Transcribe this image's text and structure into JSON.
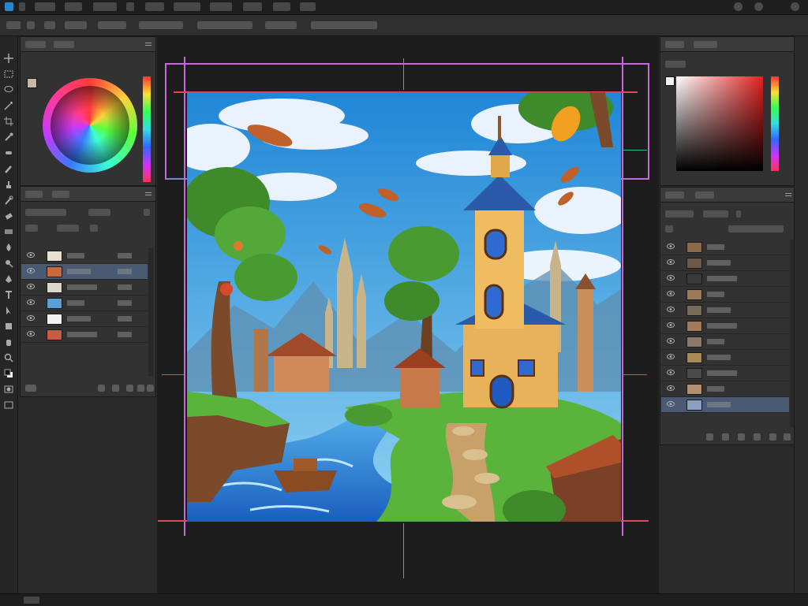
{
  "app": {
    "menus": [
      "",
      "",
      "",
      "",
      "",
      "",
      "",
      "",
      "",
      "",
      "",
      "",
      "",
      ""
    ],
    "window_controls": [
      "minimize-icon",
      "maximize-icon",
      "close-icon"
    ]
  },
  "options_bar": {
    "items": [
      "",
      "",
      "",
      "",
      "",
      "",
      "",
      "",
      ""
    ]
  },
  "toolbar": {
    "tools": [
      "move-icon",
      "marquee-icon",
      "lasso-icon",
      "magic-wand-icon",
      "crop-icon",
      "eyedropper-icon",
      "healing-icon",
      "brush-icon",
      "stamp-icon",
      "history-brush-icon",
      "eraser-icon",
      "gradient-icon",
      "blur-icon",
      "dodge-icon",
      "pen-icon",
      "type-icon",
      "path-select-icon",
      "shape-icon",
      "hand-icon",
      "zoom-icon",
      "foreground-background-swatch",
      "quick-mask-icon",
      "screen-mode-icon"
    ]
  },
  "color_wheel_panel": {
    "tabs": [
      "",
      ""
    ]
  },
  "layers_panel_left": {
    "tabs": [
      "",
      ""
    ],
    "layers": [
      {
        "name": "",
        "thumb_color": "#e8e0d0",
        "value": ""
      },
      {
        "name": "",
        "thumb_color": "#c86a3a",
        "value": "",
        "selected": true
      },
      {
        "name": "",
        "thumb_color": "#dcd6cc",
        "value": ""
      },
      {
        "name": "",
        "thumb_color": "#5aa0d8",
        "value": ""
      },
      {
        "name": "",
        "thumb_color": "#f2f2f2",
        "value": ""
      },
      {
        "name": "",
        "thumb_color": "#c85a46",
        "value": ""
      }
    ]
  },
  "color_picker_panel": {
    "tabs": [
      "",
      ""
    ],
    "label": ""
  },
  "layers_panel_right": {
    "tabs": [
      "",
      ""
    ],
    "layers": [
      {
        "name": "",
        "thumb_color": "#8a6a4a"
      },
      {
        "name": "",
        "thumb_color": "#6a5a4a"
      },
      {
        "name": "",
        "thumb_color": "#3a3a3a"
      },
      {
        "name": "",
        "thumb_color": "#9a7a5a"
      },
      {
        "name": "",
        "thumb_color": "#7a6a5a"
      },
      {
        "name": "",
        "thumb_color": "#a07a5a"
      },
      {
        "name": "",
        "thumb_color": "#8a7a6a"
      },
      {
        "name": "",
        "thumb_color": "#a88a5a"
      },
      {
        "name": "",
        "thumb_color": "#4a4a4a"
      },
      {
        "name": "",
        "thumb_color": "#b09070"
      },
      {
        "name": "",
        "thumb_color": "#8aa0c0",
        "selected": true
      }
    ]
  },
  "canvas": {
    "guide_colors": [
      "#c46ad8",
      "#2fb7a6",
      "#e0485a",
      "#6a8ae0"
    ],
    "palette": {
      "sky": "#2f9ae0",
      "water": "#2a7ad8",
      "grass": "#5ab33a",
      "tower": "#e8b25a",
      "roof": "#2b5aa8"
    }
  },
  "status": {
    "text": ""
  }
}
